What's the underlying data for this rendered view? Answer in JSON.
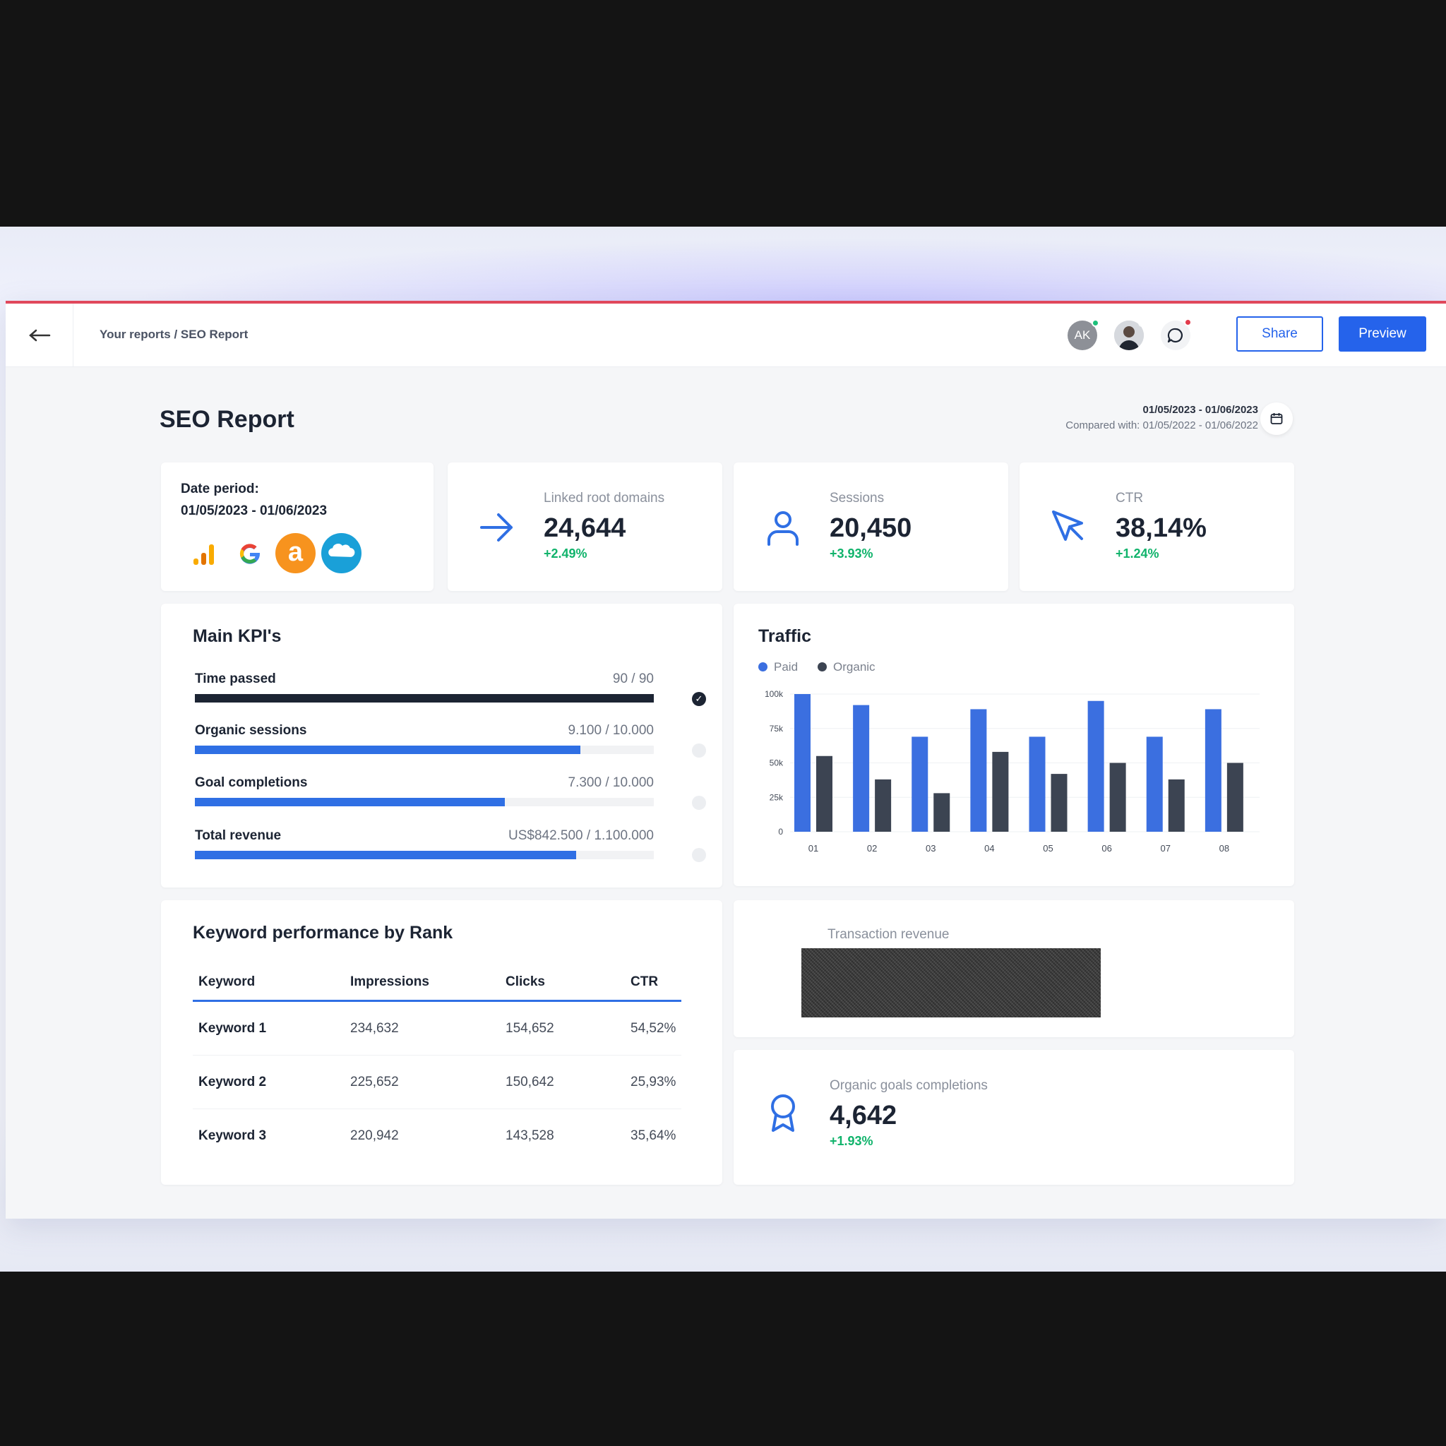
{
  "topbar": {
    "breadcrumb": "Your reports / SEO Report",
    "avatar_initials": "AK",
    "share_label": "Share",
    "preview_label": "Preview"
  },
  "report": {
    "title": "SEO Report",
    "date_range": "01/05/2023 - 01/06/2023",
    "compared_with": "Compared with: 01/05/2022 - 01/06/2022"
  },
  "date_card": {
    "label": "Date period:",
    "value": "01/05/2023 - 01/06/2023",
    "sources": [
      "google-analytics-icon",
      "google-icon",
      "amazon-icon",
      "salesforce-icon"
    ]
  },
  "stats": [
    {
      "label": "Linked root domains",
      "value": "24,644",
      "delta": "+2.49%",
      "icon": "arrow-right-icon"
    },
    {
      "label": "Sessions",
      "value": "20,450",
      "delta": "+3.93%",
      "icon": "user-icon"
    },
    {
      "label": "CTR",
      "value": "38,14%",
      "delta": "+1.24%",
      "icon": "cursor-icon"
    }
  ],
  "main_kpis": {
    "title": "Main KPI's",
    "rows": [
      {
        "name": "Time passed",
        "value": "90 / 90",
        "progress": 1.0,
        "done": true
      },
      {
        "name": "Organic sessions",
        "value": "9.100 / 10.000",
        "progress": 0.84,
        "done": false
      },
      {
        "name": "Goal completions",
        "value": "7.300 / 10.000",
        "progress": 0.676,
        "done": false
      },
      {
        "name": "Total revenue",
        "value": "US$842.500 / 1.100.000",
        "progress": 0.83,
        "done": false
      }
    ]
  },
  "traffic": {
    "title": "Traffic",
    "legend": [
      "Paid",
      "Organic"
    ],
    "colors": {
      "paid": "#3b6fe0",
      "organic": "#3c4452"
    }
  },
  "chart_data": {
    "type": "bar",
    "categories": [
      "01",
      "02",
      "03",
      "04",
      "05",
      "06",
      "07",
      "08"
    ],
    "series": [
      {
        "name": "Paid",
        "values": [
          100,
          92,
          69,
          89,
          69,
          95,
          69,
          89
        ]
      },
      {
        "name": "Organic",
        "values": [
          55,
          38,
          28,
          58,
          42,
          50,
          38,
          50
        ]
      }
    ],
    "y_ticks": [
      "0",
      "25k",
      "50k",
      "75k",
      "100k"
    ],
    "ylim": [
      0,
      100
    ],
    "grid": true,
    "legend_position": "top-left"
  },
  "keywords": {
    "title": "Keyword performance by Rank",
    "headers": [
      "Keyword",
      "Impressions",
      "Clicks",
      "CTR"
    ],
    "rows": [
      [
        "Keyword 1",
        "234,632",
        "154,652",
        "54,52%"
      ],
      [
        "Keyword 2",
        "225,652",
        "150,642",
        "25,93%"
      ],
      [
        "Keyword 3",
        "220,942",
        "143,528",
        "35,64%"
      ]
    ]
  },
  "transaction": {
    "label": "Transaction revenue"
  },
  "organic_goals": {
    "label": "Organic goals completions",
    "value": "4,642",
    "delta": "+1.93%",
    "icon": "award-icon"
  }
}
